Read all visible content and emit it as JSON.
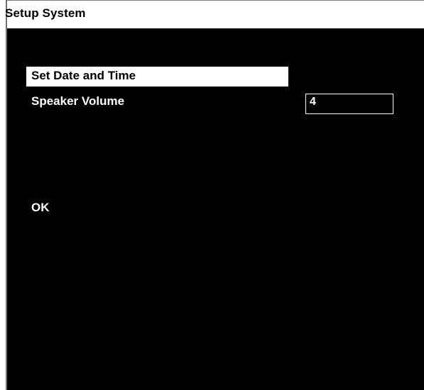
{
  "window": {
    "title": "Setup System"
  },
  "menu": {
    "items": [
      {
        "label": "Set Date and Time",
        "selected": true
      },
      {
        "label": "Speaker Volume",
        "value": "4"
      },
      {
        "label": "OK"
      }
    ]
  },
  "colors": {
    "background": "#000000",
    "foreground": "#ffffff",
    "selection_background": "#ffffff",
    "selection_foreground": "#000000"
  }
}
